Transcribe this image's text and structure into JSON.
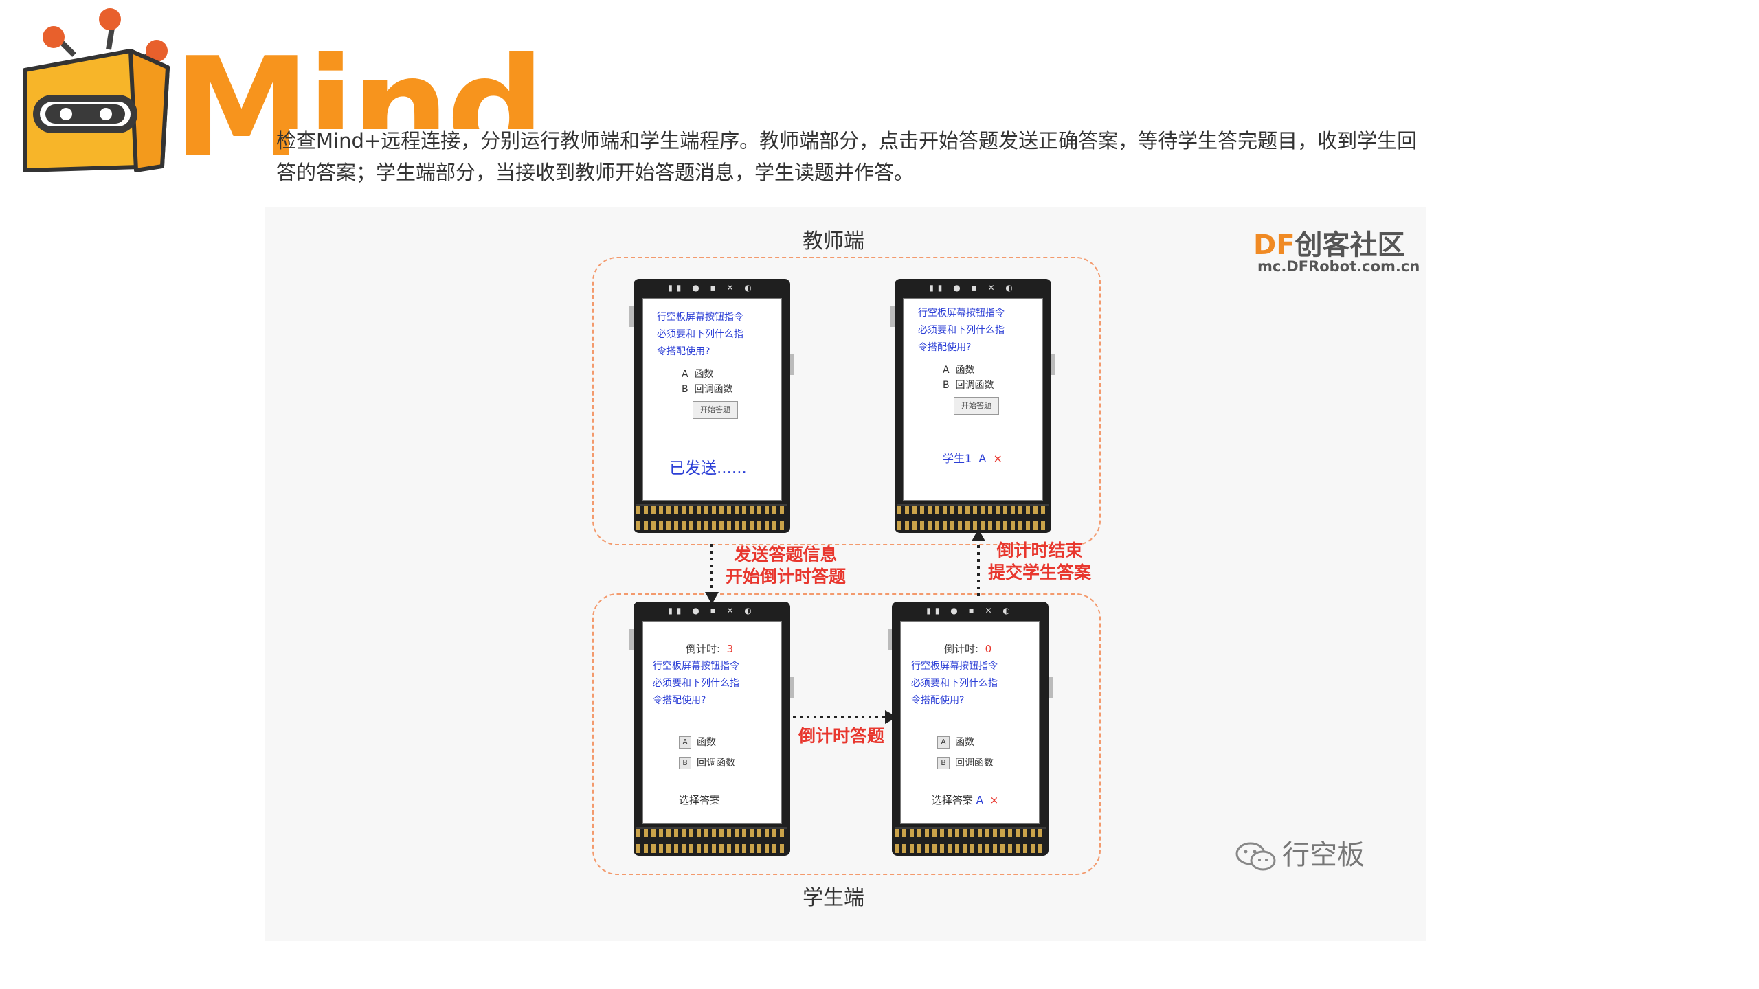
{
  "logo": {
    "text": "Mind+"
  },
  "article": {
    "paragraph": "检查Mind+远程连接，分别运行教师端和学生端程序。教师端部分，点击开始答题发送正确答案，等待学生答完题目，收到学生回答的答案；学生端部分，当接收到教师开始答题消息，学生读题并作答。"
  },
  "figure": {
    "watermark_brand_df": "DF",
    "watermark_brand_rest": "创客社区",
    "watermark_url": "mc.DFRobot.com.cn",
    "watermark_wechat": "行空板",
    "teacher_label": "教师端",
    "student_label": "学生端",
    "flow_send_line1": "发送答题信息",
    "flow_send_line2": "开始倒计时答题",
    "flow_countdown": "倒计时答题",
    "flow_submit_line1": "倒计时结束",
    "flow_submit_line2": "提交学生答案",
    "screen": {
      "question_l1": "行空板屏幕按钮指令",
      "question_l2": "必须要和下列什么指",
      "question_l3": "令搭配使用?",
      "option_a_letter": "A",
      "option_a_text": "函数",
      "option_b_letter": "B",
      "option_b_text": "回调函数",
      "start_button": "开始答题",
      "sent_text": "已发送......",
      "result_student": "学生1",
      "result_answer": "A",
      "result_mark": "×",
      "countdown_label": "倒计时:",
      "countdown_start": "3",
      "countdown_end": "0",
      "choose_label": "选择答案",
      "chosen_answer": "A",
      "chosen_mark": "×"
    }
  }
}
